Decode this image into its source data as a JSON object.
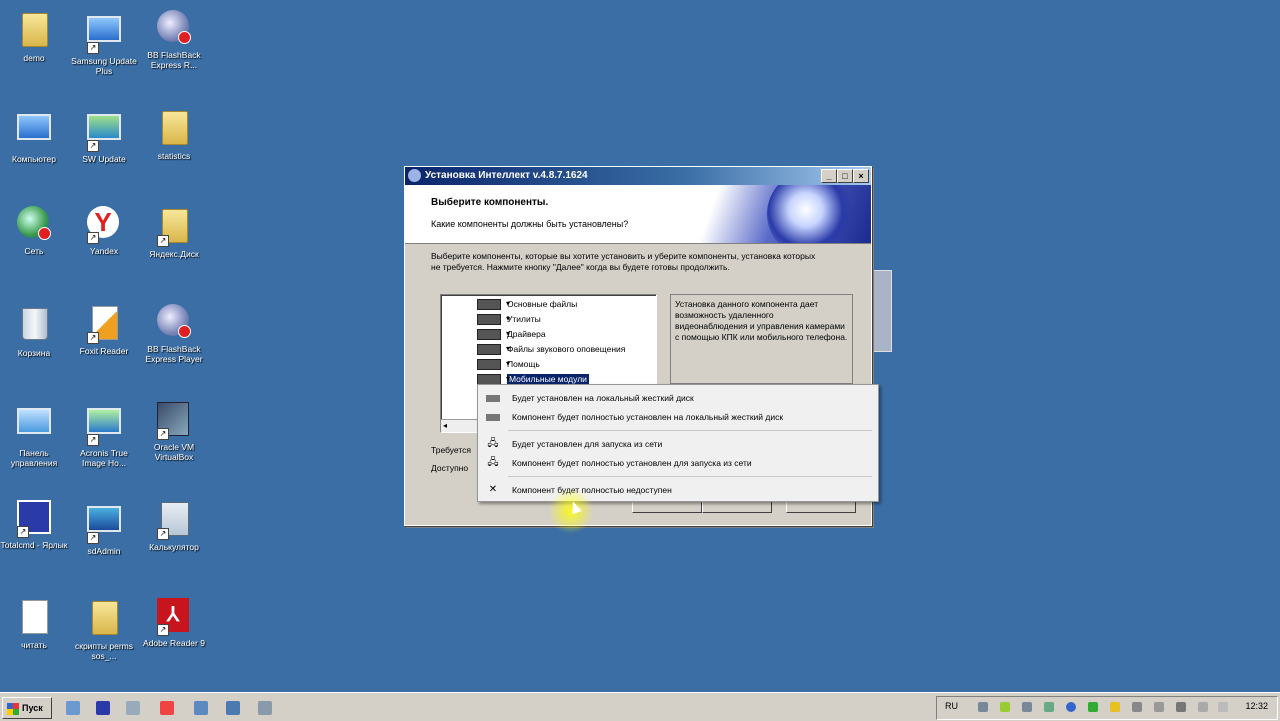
{
  "desktop": {
    "icons": [
      {
        "label": "demo"
      },
      {
        "label": "Samsung Update Plus"
      },
      {
        "label": "BB FlashBack Express R..."
      },
      {
        "label": "Компьютер"
      },
      {
        "label": "SW Update"
      },
      {
        "label": "statistics"
      },
      {
        "label": "Сеть"
      },
      {
        "label": "Yandex"
      },
      {
        "label": "Яндекс.Диск"
      },
      {
        "label": "Корзина"
      },
      {
        "label": "Foxit Reader"
      },
      {
        "label": "BB FlashBack Express Player"
      },
      {
        "label": "Панель управления"
      },
      {
        "label": "Acronis True Image Ho..."
      },
      {
        "label": "Oracle VM VirtualBox"
      },
      {
        "label": "Totalcmd - Ярлык"
      },
      {
        "label": "sdAdmin"
      },
      {
        "label": "Калькулятор"
      },
      {
        "label": "читать"
      },
      {
        "label": "скрипты perms sos_..."
      },
      {
        "label": "Adobe Reader 9"
      }
    ]
  },
  "installer": {
    "title": "Установка Интеллект v.4.8.7.1624",
    "heading": "Выберите компоненты.",
    "subheading": "Какие компоненты должны быть установлены?",
    "description": "Выберите компоненты, которые вы хотите установить и уберите компоненты, установка которых не требуется. Нажмите кнопку \"Далее\" когда вы будете готовы продолжить.",
    "tree_items": [
      {
        "label": "Основные файлы"
      },
      {
        "label": "Утилиты"
      },
      {
        "label": "Драйвера"
      },
      {
        "label": "Файлы звукового оповещения"
      },
      {
        "label": "Помощь"
      },
      {
        "label": "Мобильные модули"
      }
    ],
    "info_text": "Установка данного компонента дает возможность удаленного видеонаблюдения и управления камерами с помощью КПК или мобильного телефона.",
    "required_label": "Требуется",
    "available_label": "Доступно"
  },
  "context_menu": {
    "items": [
      {
        "label": "Будет установлен на локальный жесткий диск",
        "icon": "hdd-icon"
      },
      {
        "label": "Компонент будет полностью установлен на локальный жесткий диск",
        "icon": "hdd-full-icon"
      },
      {
        "label": "Будет установлен для запуска из сети",
        "icon": "network-icon"
      },
      {
        "label": "Компонент будет полностью установлен для запуска из сети",
        "icon": "network-full-icon"
      },
      {
        "label": "Компонент будет полностью недоступен",
        "icon": "x-icon"
      }
    ]
  },
  "taskbar": {
    "start_label": "Пуск",
    "language": "RU",
    "clock": "12:32"
  }
}
